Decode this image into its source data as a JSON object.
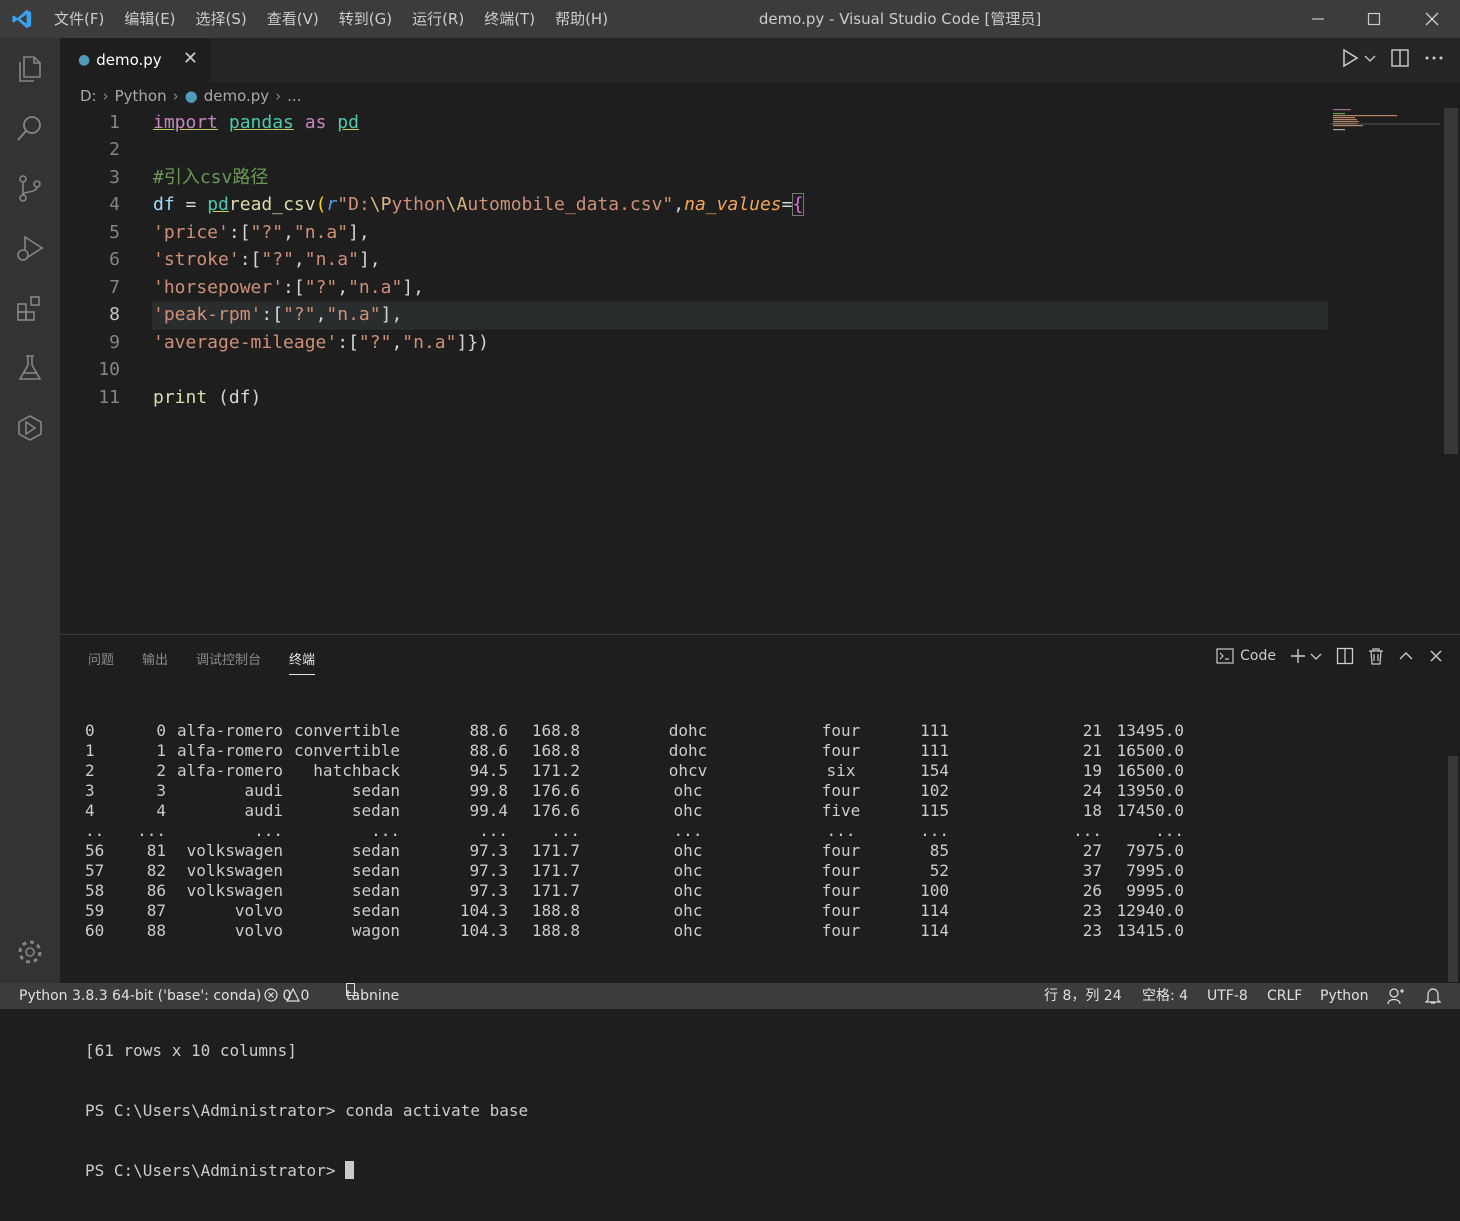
{
  "titlebar": {
    "menu": [
      "文件(F)",
      "编辑(E)",
      "选择(S)",
      "查看(V)",
      "转到(G)",
      "运行(R)",
      "终端(T)",
      "帮助(H)"
    ],
    "title": "demo.py - Visual Studio Code [管理员]"
  },
  "activity_icons": [
    "explorer-icon",
    "search-icon",
    "source-control-icon",
    "run-debug-icon",
    "extensions-icon",
    "testing-icon",
    "remote-icon",
    "settings-gear-icon"
  ],
  "tab": {
    "label": "demo.py",
    "close": "✕"
  },
  "breadcrumb": [
    "D:",
    "Python",
    "demo.py",
    "..."
  ],
  "editor": {
    "line_numbers": [
      "1",
      "2",
      "3",
      "4",
      "5",
      "6",
      "7",
      "8",
      "9",
      "10",
      "11"
    ],
    "current_line": 8
  },
  "code": {
    "l1": {
      "import": "import",
      "pandas": "pandas",
      "as": "as",
      "pd": "pd"
    },
    "l3": {
      "comment": "#引入csv路径"
    },
    "l4": {
      "df": "df",
      "eq": " = ",
      "pd": "pd",
      ".": ".",
      "fn": "read_csv",
      "open": "(",
      "r": "r",
      "str1": "\"D:",
      "esc": "\\P",
      "str2": "ython",
      "esc2": "\\A",
      "str3": "utomobile_data.csv\"",
      "comma": ",",
      "param": "na_values",
      "assign": "=",
      "brace": "{"
    },
    "l5": {
      "key": "'price'",
      "rest": ":[",
      "v1": "\"?\"",
      "sep": ",",
      "v2": "\"n.a\"",
      "end": "],"
    },
    "l6": {
      "key": "'stroke'",
      "rest": ":[",
      "v1": "\"?\"",
      "sep": ",",
      "v2": "\"n.a\"",
      "end": "],"
    },
    "l7": {
      "key": "'horsepower'",
      "rest": ":[",
      "v1": "\"?\"",
      "sep": ",",
      "v2": "\"n.a\"",
      "end": "],"
    },
    "l8": {
      "key": "'peak-rpm'",
      "rest": ":[",
      "v1": "\"?\"",
      "sep": ",",
      "v2": "\"n.a\"",
      "end": "],"
    },
    "l9": {
      "key": "'average-mileage'",
      "rest": ":[",
      "v1": "\"?\"",
      "sep": ",",
      "v2": "\"n.a\"",
      "end": "]})"
    },
    "l11": {
      "fn": "print",
      "rest": " (df)"
    }
  },
  "panel": {
    "tabs": [
      "问题",
      "输出",
      "调试控制台",
      "终端"
    ],
    "terminal_name": "Code"
  },
  "terminal": {
    "rows": [
      [
        "0",
        "0",
        "alfa-romero",
        "convertible",
        "88.6",
        "168.8",
        "dohc",
        "four",
        "111",
        "21",
        "13495.0"
      ],
      [
        "1",
        "1",
        "alfa-romero",
        "convertible",
        "88.6",
        "168.8",
        "dohc",
        "four",
        "111",
        "21",
        "16500.0"
      ],
      [
        "2",
        "2",
        "alfa-romero",
        "hatchback",
        "94.5",
        "171.2",
        "ohcv",
        "six",
        "154",
        "19",
        "16500.0"
      ],
      [
        "3",
        "3",
        "audi",
        "sedan",
        "99.8",
        "176.6",
        "ohc",
        "four",
        "102",
        "24",
        "13950.0"
      ],
      [
        "4",
        "4",
        "audi",
        "sedan",
        "99.4",
        "176.6",
        "ohc",
        "five",
        "115",
        "18",
        "17450.0"
      ],
      [
        "..",
        "...",
        "...",
        "...",
        "...",
        "...",
        "...",
        "...",
        "...",
        "...",
        "..."
      ],
      [
        "56",
        "81",
        "volkswagen",
        "sedan",
        "97.3",
        "171.7",
        "ohc",
        "four",
        "85",
        "27",
        "7975.0"
      ],
      [
        "57",
        "82",
        "volkswagen",
        "sedan",
        "97.3",
        "171.7",
        "ohc",
        "four",
        "52",
        "37",
        "7995.0"
      ],
      [
        "58",
        "86",
        "volkswagen",
        "sedan",
        "97.3",
        "171.7",
        "ohc",
        "four",
        "100",
        "26",
        "9995.0"
      ],
      [
        "59",
        "87",
        "volvo",
        "sedan",
        "104.3",
        "188.8",
        "ohc",
        "four",
        "114",
        "23",
        "12940.0"
      ],
      [
        "60",
        "88",
        "volvo",
        "wagon",
        "104.3",
        "188.8",
        "ohc",
        "four",
        "114",
        "23",
        "13415.0"
      ]
    ],
    "summary": "[61 rows x 10 columns]",
    "prompt1": "PS C:\\Users\\Administrator> conda activate base",
    "prompt2": "PS C:\\Users\\Administrator> "
  },
  "status": {
    "interpreter": "Python 3.8.3 64-bit ('base': conda)",
    "errors": "0",
    "warnings": "0",
    "tabnine": "tabnine",
    "position": "行 8，列 24",
    "spaces": "空格: 4",
    "encoding": "UTF-8",
    "eol": "CRLF",
    "language": "Python"
  }
}
